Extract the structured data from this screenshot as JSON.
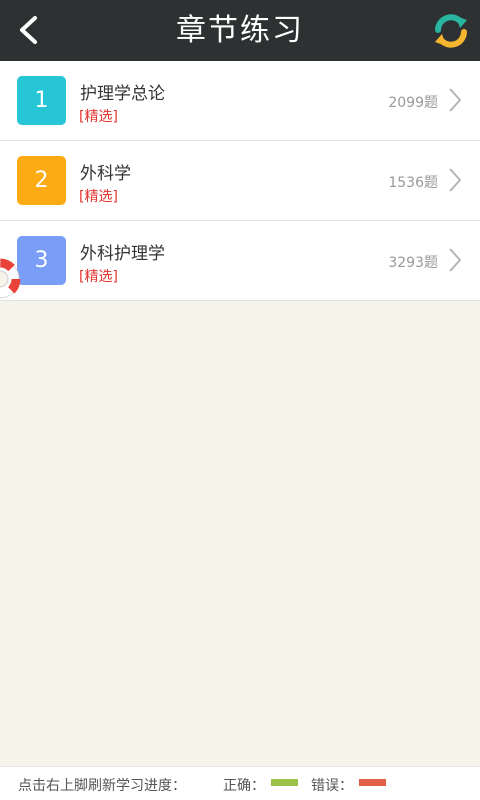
{
  "header": {
    "title": "章节练习"
  },
  "chapters": [
    {
      "index": "1",
      "name": "护理学总论",
      "tag": "[精选]",
      "count": "2099题",
      "color": "#27c6d6"
    },
    {
      "index": "2",
      "name": "外科学",
      "tag": "[精选]",
      "count": "1536题",
      "color": "#fdab14"
    },
    {
      "index": "3",
      "name": "外科护理学",
      "tag": "[精选]",
      "count": "3293题",
      "color": "#7a9ef8"
    }
  ],
  "footer": {
    "hint": "点击右上脚刷新学习进度：",
    "correct_label": "正确：",
    "wrong_label": "错误：",
    "correct_color": "#9bc146",
    "wrong_color": "#e2604a"
  },
  "icons": {
    "back": "chevron-left-icon",
    "refresh": "refresh-icon",
    "row_arrow": "chevron-right-icon",
    "floating": "lifebuoy-icon"
  }
}
